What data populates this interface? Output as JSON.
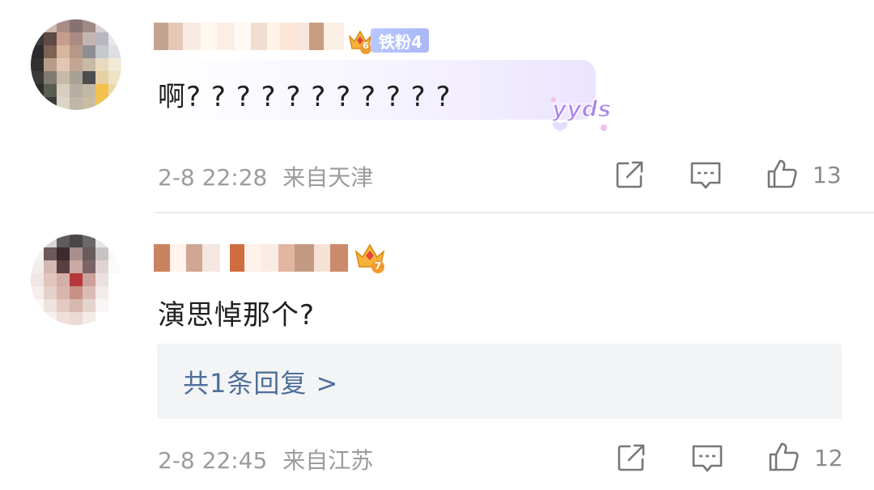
{
  "comments": [
    {
      "fan_label": "铁粉4",
      "fan_level": "6",
      "text": "啊? ? ? ? ? ? ? ? ? ? ?",
      "sticker_text": "yyds",
      "time": "2-8 22:28",
      "location": "来自天津",
      "likes": "13",
      "icons": [
        "share-icon",
        "comment-icon",
        "like-icon"
      ]
    },
    {
      "crown_level": "7",
      "text": "演思悼那个?",
      "replies_label": "共1条回复 >",
      "time": "2-8 22:45",
      "location": "来自江苏",
      "likes": "12",
      "icons": [
        "share-icon",
        "comment-icon",
        "like-icon"
      ]
    }
  ],
  "colors": {
    "meta_text": "#9b9b9b",
    "reply_link": "#4f6f9a",
    "fan_badge": "#b9c7ff",
    "crown_gold": "#f5b33a",
    "sticker_purple": "#a985ee"
  }
}
